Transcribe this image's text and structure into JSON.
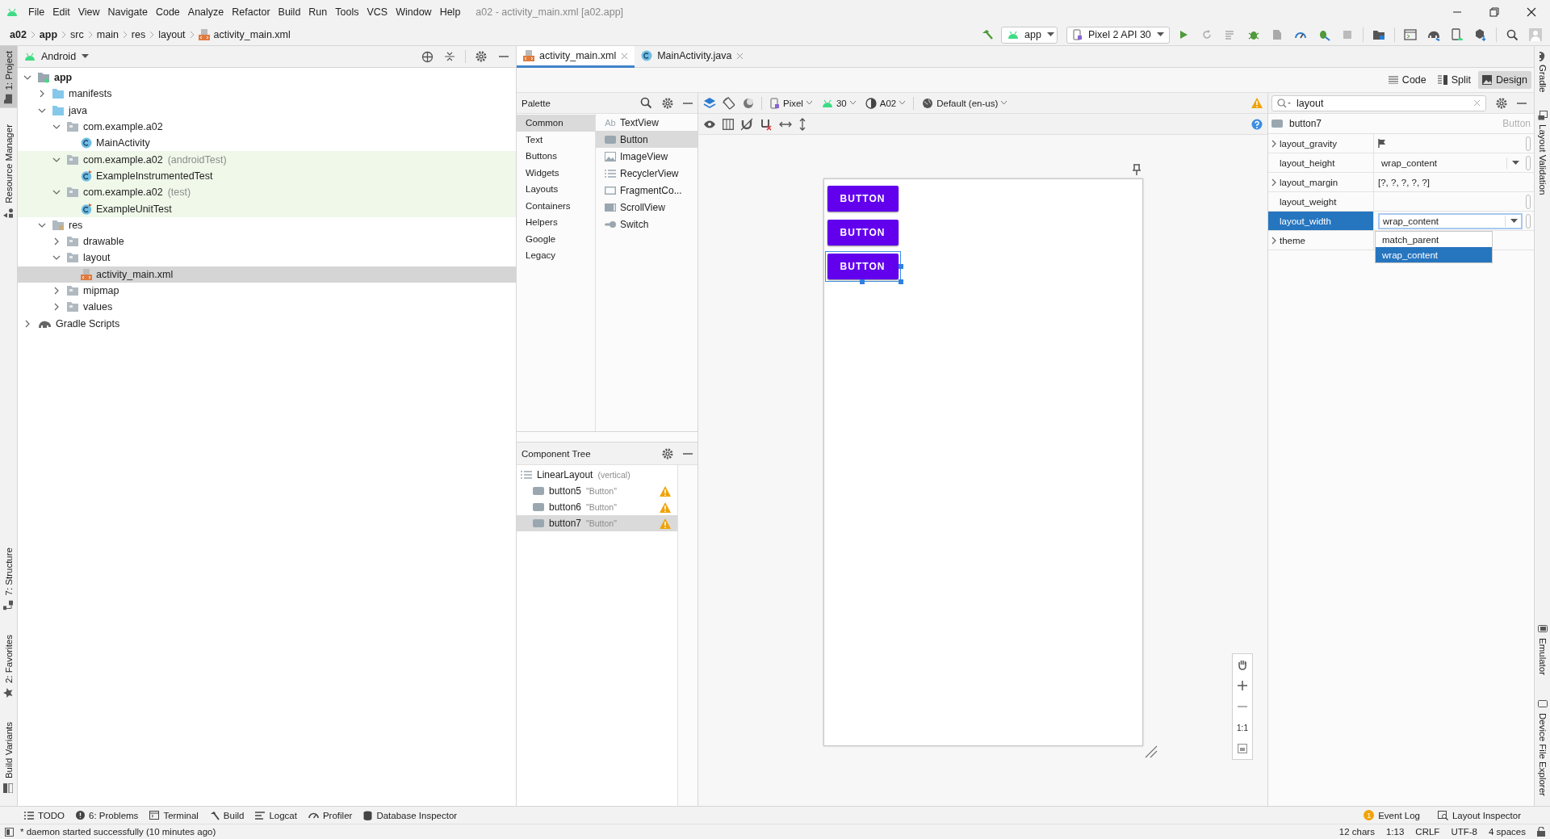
{
  "window": {
    "title": "a02 - activity_main.xml [a02.app]"
  },
  "menu": [
    "File",
    "Edit",
    "View",
    "Navigate",
    "Code",
    "Analyze",
    "Refactor",
    "Build",
    "Run",
    "Tools",
    "VCS",
    "Window",
    "Help"
  ],
  "breadcrumb": [
    {
      "label": "a02",
      "kind": "module"
    },
    {
      "label": "app",
      "kind": "module"
    },
    {
      "label": "src",
      "kind": "folder"
    },
    {
      "label": "main",
      "kind": "folder"
    },
    {
      "label": "res",
      "kind": "folder"
    },
    {
      "label": "layout",
      "kind": "folder"
    },
    {
      "label": "activity_main.xml",
      "kind": "layout_file"
    }
  ],
  "toolbar": {
    "run_config": "app",
    "device": "Pixel 2 API 30"
  },
  "left_tool_windows": {
    "top": [
      {
        "label": "1: Project",
        "selected": true
      },
      {
        "label": "Resource Manager",
        "selected": false
      }
    ],
    "bottom": [
      {
        "label": "7: Structure",
        "selected": false
      },
      {
        "label": "2: Favorites",
        "selected": false
      },
      {
        "label": "Build Variants",
        "selected": false
      }
    ]
  },
  "right_tool_windows": {
    "top": [
      "Gradle",
      "Layout Validation"
    ],
    "bottom": [
      "Emulator",
      "Device File Explorer"
    ]
  },
  "project": {
    "view": "Android",
    "tree": [
      {
        "label": "app",
        "kind": "module",
        "expanded": true,
        "selected": false,
        "highlighted": false,
        "children": [
          {
            "label": "manifests",
            "kind": "source_folder",
            "expanded": false,
            "selected": false,
            "highlighted": false
          },
          {
            "label": "java",
            "kind": "source_folder",
            "expanded": true,
            "selected": false,
            "highlighted": false,
            "children": [
              {
                "label": "com.example.a02",
                "kind": "package",
                "expanded": true,
                "selected": false,
                "highlighted": false,
                "children": [
                  {
                    "label": "MainActivity",
                    "kind": "class",
                    "selected": false,
                    "highlighted": false
                  }
                ]
              },
              {
                "label": "com.example.a02",
                "note": "(androidTest)",
                "kind": "package",
                "expanded": true,
                "selected": false,
                "highlighted": true,
                "children": [
                  {
                    "label": "ExampleInstrumentedTest",
                    "kind": "test_class",
                    "selected": false,
                    "highlighted": true
                  }
                ]
              },
              {
                "label": "com.example.a02",
                "note": "(test)",
                "kind": "package",
                "expanded": true,
                "selected": false,
                "highlighted": true,
                "children": [
                  {
                    "label": "ExampleUnitTest",
                    "kind": "test_class",
                    "selected": false,
                    "highlighted": true
                  }
                ]
              }
            ]
          },
          {
            "label": "res",
            "kind": "res_folder",
            "expanded": true,
            "selected": false,
            "highlighted": false,
            "children": [
              {
                "label": "drawable",
                "kind": "package",
                "expanded": false,
                "selected": false,
                "highlighted": false
              },
              {
                "label": "layout",
                "kind": "package",
                "expanded": true,
                "selected": false,
                "highlighted": false,
                "children": [
                  {
                    "label": "activity_main.xml",
                    "kind": "layout_file",
                    "selected": true,
                    "highlighted": false
                  }
                ]
              },
              {
                "label": "mipmap",
                "kind": "package",
                "expanded": false,
                "selected": false,
                "highlighted": false
              },
              {
                "label": "values",
                "kind": "package",
                "expanded": false,
                "selected": false,
                "highlighted": false
              }
            ]
          }
        ]
      },
      {
        "label": "Gradle Scripts",
        "kind": "gradle",
        "expanded": false,
        "selected": false,
        "highlighted": false
      }
    ]
  },
  "editor_tabs": [
    {
      "label": "activity_main.xml",
      "kind": "layout_file",
      "selected": true
    },
    {
      "label": "MainActivity.java",
      "kind": "class",
      "selected": false
    }
  ],
  "view_modes": [
    {
      "label": "Code",
      "kind": "code",
      "selected": false
    },
    {
      "label": "Split",
      "kind": "split",
      "selected": false
    },
    {
      "label": "Design",
      "kind": "design",
      "selected": true
    }
  ],
  "palette": {
    "title": "Palette",
    "categories": [
      {
        "label": "Common",
        "selected": true
      },
      {
        "label": "Text",
        "selected": false
      },
      {
        "label": "Buttons",
        "selected": false
      },
      {
        "label": "Widgets",
        "selected": false
      },
      {
        "label": "Layouts",
        "selected": false
      },
      {
        "label": "Containers",
        "selected": false
      },
      {
        "label": "Helpers",
        "selected": false
      },
      {
        "label": "Google",
        "selected": false
      },
      {
        "label": "Legacy",
        "selected": false
      }
    ],
    "items": [
      {
        "label": "TextView",
        "kind": "text",
        "glyph": "Ab",
        "selected": false
      },
      {
        "label": "Button",
        "kind": "button",
        "selected": true
      },
      {
        "label": "ImageView",
        "kind": "image",
        "selected": false
      },
      {
        "label": "RecyclerView",
        "kind": "list",
        "selected": false
      },
      {
        "label": "FragmentCo...",
        "kind": "fragment",
        "selected": false
      },
      {
        "label": "ScrollView",
        "kind": "scroll",
        "selected": false
      },
      {
        "label": "Switch",
        "kind": "switch",
        "selected": false
      }
    ]
  },
  "design_toolbar": {
    "device": "Pixel",
    "api": "30",
    "theme": "A02",
    "locale": "Default (en-us)"
  },
  "component_tree": {
    "title": "Component Tree",
    "root": {
      "label": "LinearLayout",
      "note": "(vertical)"
    },
    "children": [
      {
        "label": "button5",
        "text": "\"Button\"",
        "warning": true,
        "selected": false
      },
      {
        "label": "button6",
        "text": "\"Button\"",
        "warning": true,
        "selected": false
      },
      {
        "label": "button7",
        "text": "\"Button\"",
        "warning": true,
        "selected": true
      }
    ]
  },
  "canvas": {
    "buttons": [
      {
        "label": "BUTTON",
        "selected": false
      },
      {
        "label": "BUTTON",
        "selected": false
      },
      {
        "label": "BUTTON",
        "selected": true
      }
    ],
    "zoom_label": "1:1"
  },
  "attributes": {
    "search": "layout",
    "component": {
      "name": "button7",
      "type": "Button"
    },
    "rows": [
      {
        "name": "layout_gravity",
        "kind": "flag",
        "expandable": true,
        "selected": false
      },
      {
        "name": "layout_height",
        "kind": "dropdown",
        "value": "wrap_content",
        "expandable": false,
        "selected": false
      },
      {
        "name": "layout_margin",
        "kind": "text",
        "value": "[?, ?, ?, ?, ?]",
        "expandable": true,
        "selected": false
      },
      {
        "name": "layout_weight",
        "kind": "field",
        "expandable": false,
        "selected": false
      },
      {
        "name": "layout_width",
        "kind": "dropdown",
        "value": "wrap_content",
        "expandable": false,
        "selected": true
      },
      {
        "name": "theme",
        "kind": "blank",
        "expandable": true,
        "selected": false
      }
    ],
    "dropdown_options": [
      {
        "label": "match_parent",
        "selected": false
      },
      {
        "label": "wrap_content",
        "selected": true
      }
    ]
  },
  "bottom_tools": {
    "left": [
      {
        "label": "TODO",
        "kind": "list"
      },
      {
        "label": "6: Problems",
        "kind": "problems"
      },
      {
        "label": "Terminal",
        "kind": "terminal"
      },
      {
        "label": "Build",
        "kind": "build"
      },
      {
        "label": "Logcat",
        "kind": "logcat"
      },
      {
        "label": "Profiler",
        "kind": "profiler"
      },
      {
        "label": "Database Inspector",
        "kind": "database"
      }
    ],
    "right": [
      {
        "label": "Event Log",
        "kind": "events",
        "badge": "1"
      },
      {
        "label": "Layout Inspector",
        "kind": "inspector"
      }
    ]
  },
  "status_bar": {
    "message": "* daemon started successfully (10 minutes ago)",
    "items": [
      "12 chars",
      "1:13",
      "CRLF",
      "UTF-8",
      "4 spaces"
    ]
  }
}
